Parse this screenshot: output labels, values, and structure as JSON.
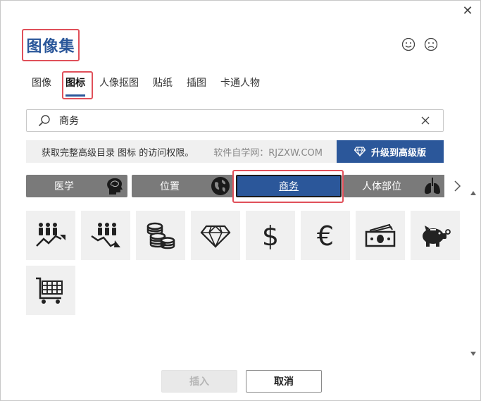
{
  "dialog": {
    "title": "图像集",
    "close_icon": "close-icon",
    "feedback": {
      "happy_icon": "smile-face-icon",
      "sad_icon": "frown-face-icon"
    }
  },
  "tabs": [
    {
      "label": "图像",
      "active": false
    },
    {
      "label": "图标",
      "active": true
    },
    {
      "label": "人像抠图",
      "active": false
    },
    {
      "label": "贴纸",
      "active": false
    },
    {
      "label": "插图",
      "active": false
    },
    {
      "label": "卡通人物",
      "active": false
    }
  ],
  "search": {
    "value": "商务",
    "icon": "search-icon",
    "clear_icon": "clear-icon"
  },
  "upgrade": {
    "message": "获取完整高级目录 图标 的访问权限。",
    "watermark": "软件自学网：RJZXW.COM",
    "button_label": "升级到高级版",
    "button_icon": "diamond-icon"
  },
  "categories": [
    {
      "label": "医学",
      "icon": "brain-head-icon",
      "active": false
    },
    {
      "label": "位置",
      "icon": "globe-icon",
      "active": false
    },
    {
      "label": "商务",
      "icon": "",
      "active": true
    },
    {
      "label": "人体部位",
      "icon": "lungs-icon",
      "active": false
    }
  ],
  "icons": [
    {
      "name": "people-growth-icon"
    },
    {
      "name": "people-decline-icon"
    },
    {
      "name": "coins-stack-icon"
    },
    {
      "name": "diamond-icon"
    },
    {
      "name": "dollar-icon"
    },
    {
      "name": "euro-icon"
    },
    {
      "name": "money-bills-icon"
    },
    {
      "name": "piggy-bank-icon"
    },
    {
      "name": "shopping-cart-icon"
    }
  ],
  "footer": {
    "insert_label": "插入",
    "cancel_label": "取消"
  },
  "colors": {
    "accent": "#2b579a",
    "highlight": "#e0505a",
    "category_bg": "#7a7a7a",
    "tile_bg": "#f0f0f0"
  }
}
